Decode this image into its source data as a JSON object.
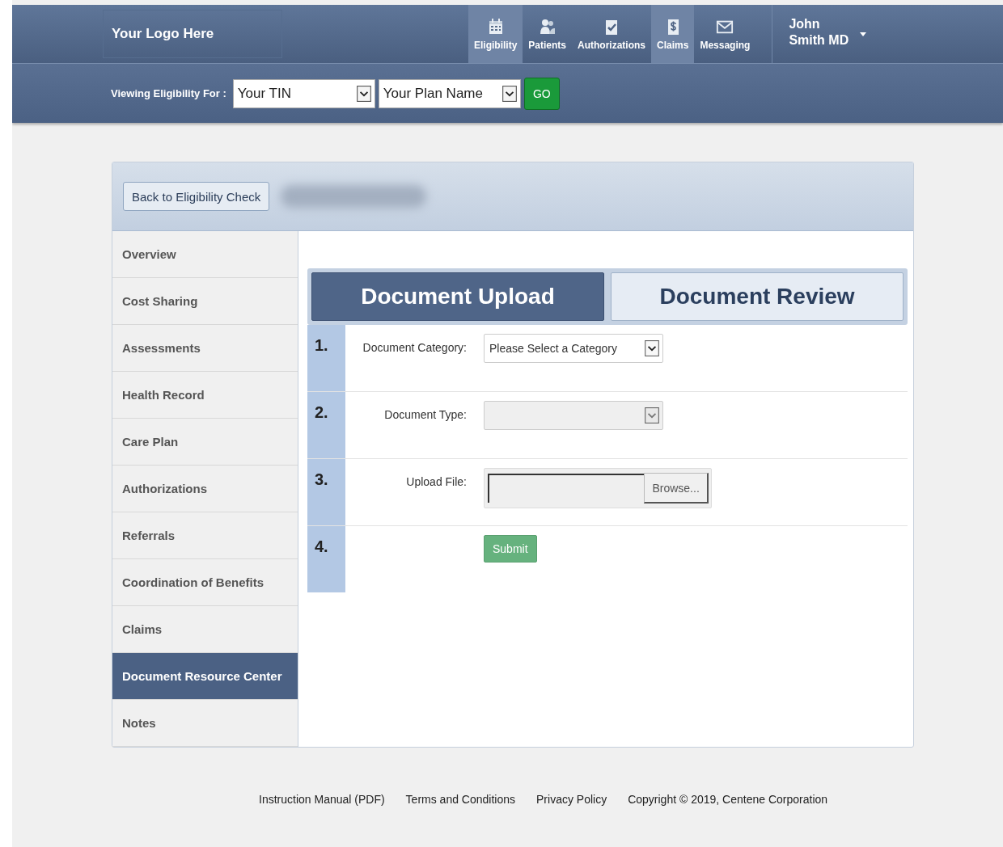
{
  "header": {
    "logo": "Your Logo Here",
    "nav": [
      {
        "label": "Eligibility",
        "kind": "calendar",
        "selected": true
      },
      {
        "label": "Patients",
        "kind": "people",
        "selected": false
      },
      {
        "label": "Authorizations",
        "kind": "check",
        "selected": false
      },
      {
        "label": "Claims",
        "kind": "dollar",
        "selected": true
      },
      {
        "label": "Messaging",
        "kind": "envelope",
        "selected": false
      }
    ],
    "user": {
      "first": "John",
      "last": "Smith MD"
    }
  },
  "toolbar": {
    "label": "Viewing Eligibility For :",
    "tin": "Your TIN",
    "plan": "Your Plan Name",
    "go": "GO"
  },
  "back_button": "Back to Eligibility Check",
  "sidebar": {
    "items": [
      {
        "label": "Overview",
        "selected": false
      },
      {
        "label": "Cost Sharing",
        "selected": false
      },
      {
        "label": "Assessments",
        "selected": false
      },
      {
        "label": "Health Record",
        "selected": false
      },
      {
        "label": "Care Plan",
        "selected": false
      },
      {
        "label": "Authorizations",
        "selected": false
      },
      {
        "label": "Referrals",
        "selected": false
      },
      {
        "label": "Coordination of Benefits",
        "selected": false
      },
      {
        "label": "Claims",
        "selected": false
      },
      {
        "label": "Document Resource Center",
        "selected": true
      },
      {
        "label": "Notes",
        "selected": false
      }
    ]
  },
  "tabs": [
    {
      "label": "Document Upload",
      "selected": true
    },
    {
      "label": "Document Review",
      "selected": false
    }
  ],
  "steps": [
    {
      "number": "1.",
      "kind": "select",
      "label": "Document Category:",
      "value": "Please Select a Category",
      "disabled": false
    },
    {
      "number": "2.",
      "kind": "select",
      "label": "Document Type:",
      "disabled": true
    },
    {
      "number": "3.",
      "kind": "file",
      "label": "Upload File:",
      "button": "Browse..."
    },
    {
      "number": "4.",
      "kind": "submit",
      "button": "Submit"
    }
  ],
  "footer": [
    "Instruction Manual (PDF)",
    "Terms and Conditions",
    "Privacy Policy",
    "Copyright © 2019, Centene Corporation"
  ]
}
